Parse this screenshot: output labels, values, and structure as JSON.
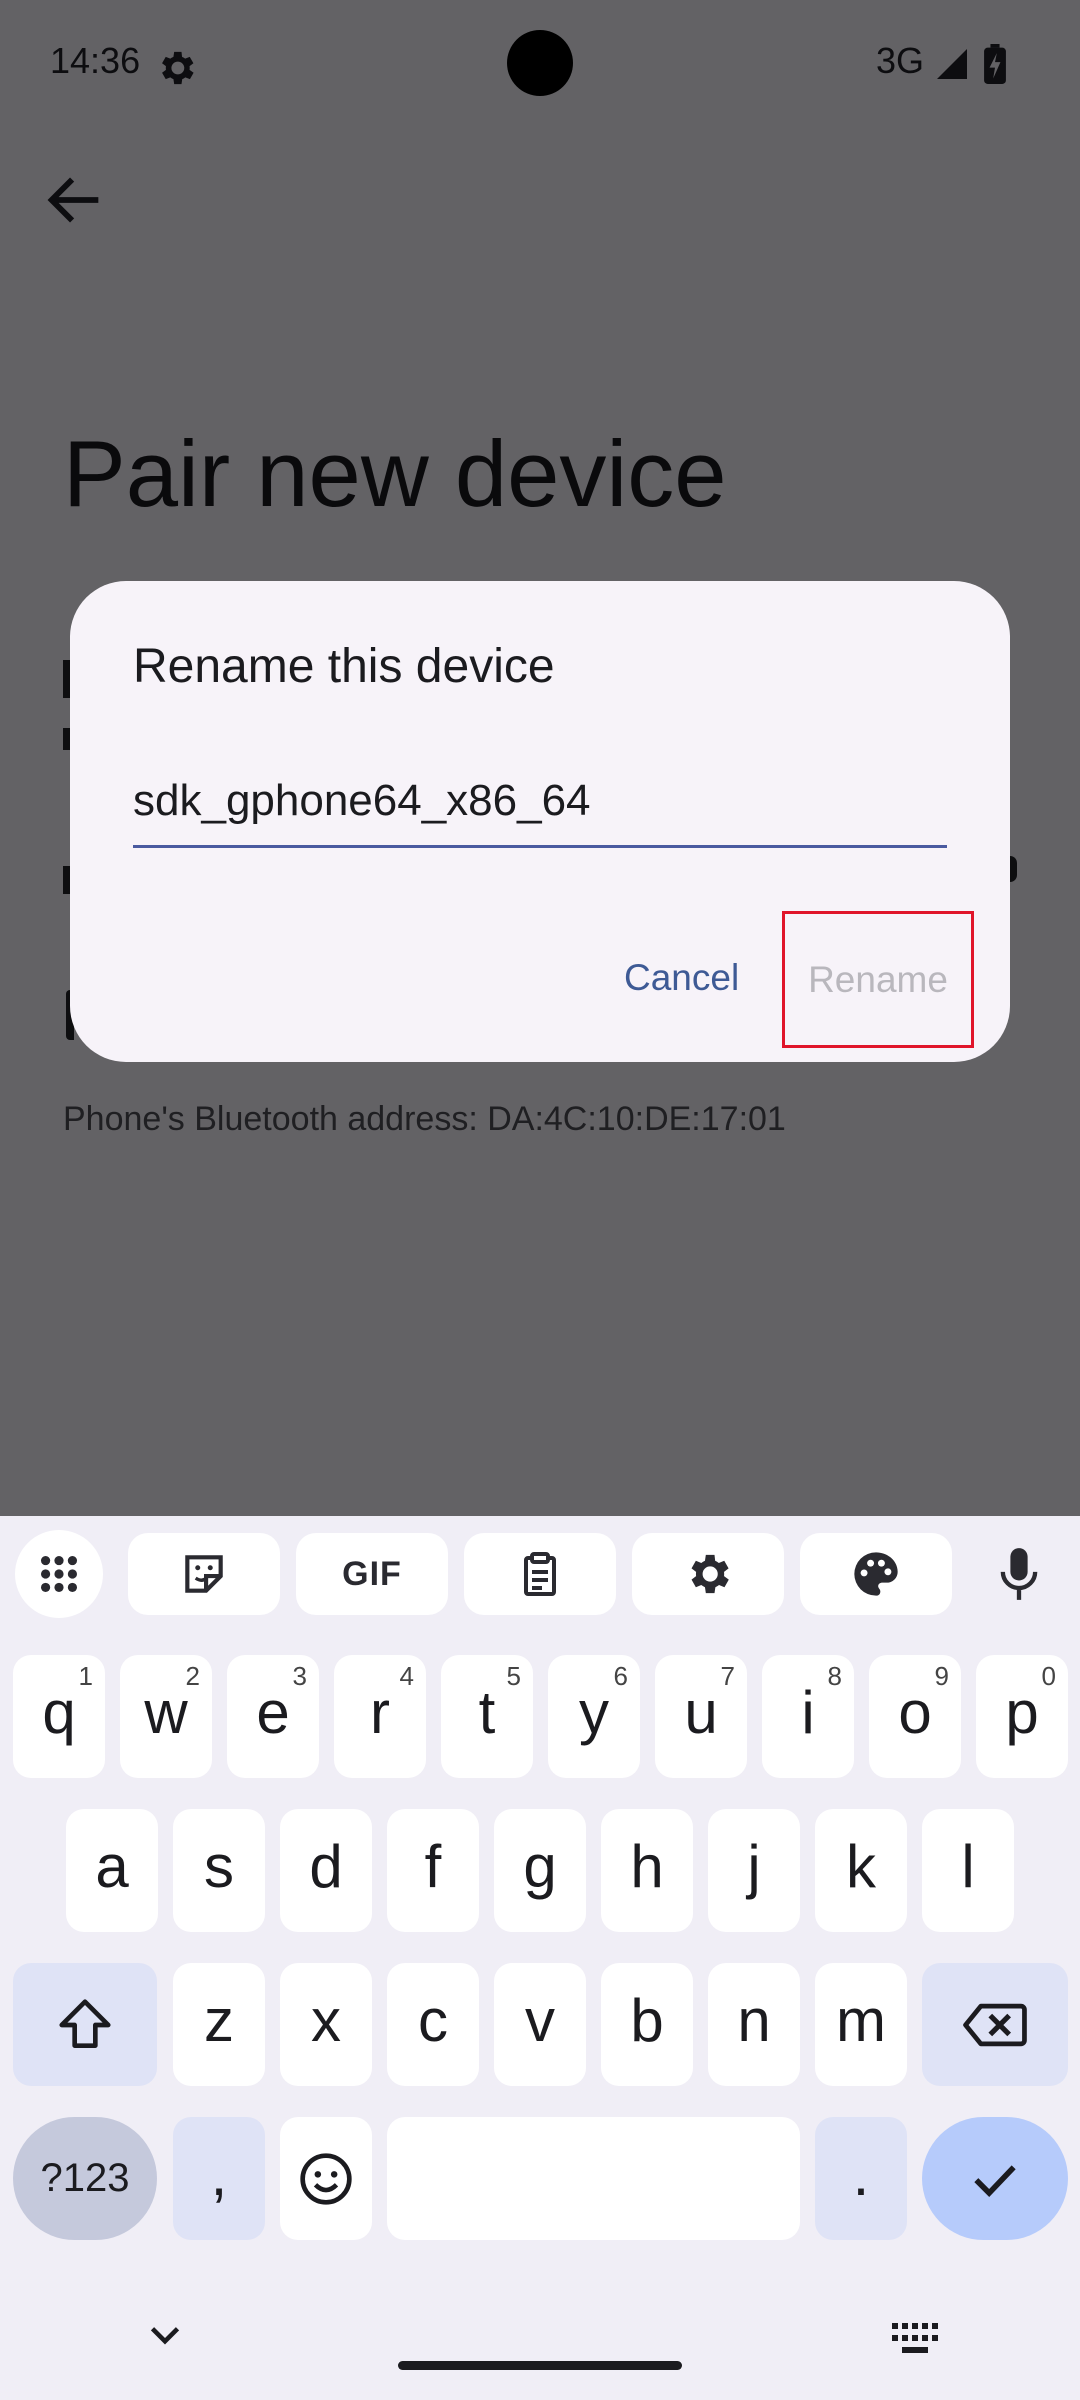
{
  "status_bar": {
    "time": "14:36",
    "network": "3G",
    "icons": [
      "settings-gear-icon",
      "signal-icon",
      "battery-charging-icon"
    ]
  },
  "page": {
    "title": "Pair new device",
    "bluetooth_address": "Phone's Bluetooth address: DA:4C:10:DE:17:01"
  },
  "dialog": {
    "title": "Rename this device",
    "field_value": "sdk_gphone64_x86_64",
    "cancel_label": "Cancel",
    "rename_label": "Rename"
  },
  "keyboard": {
    "toolbar": {
      "gif_label": "GIF",
      "icons": [
        "apps-grid-icon",
        "sticker-icon",
        "clipboard-icon",
        "settings-icon",
        "palette-icon",
        "microphone-icon"
      ]
    },
    "row1": [
      {
        "ch": "q",
        "hint": "1"
      },
      {
        "ch": "w",
        "hint": "2"
      },
      {
        "ch": "e",
        "hint": "3"
      },
      {
        "ch": "r",
        "hint": "4"
      },
      {
        "ch": "t",
        "hint": "5"
      },
      {
        "ch": "y",
        "hint": "6"
      },
      {
        "ch": "u",
        "hint": "7"
      },
      {
        "ch": "i",
        "hint": "8"
      },
      {
        "ch": "o",
        "hint": "9"
      },
      {
        "ch": "p",
        "hint": "0"
      }
    ],
    "row2": [
      "a",
      "s",
      "d",
      "f",
      "g",
      "h",
      "j",
      "k",
      "l"
    ],
    "row3": [
      "z",
      "x",
      "c",
      "v",
      "b",
      "n",
      "m"
    ],
    "symbols_label": "?123",
    "comma": ",",
    "period": "."
  },
  "colors": {
    "accent": "#3e5a95",
    "highlight_box": "#e0142a",
    "scrim": "#636265",
    "enter_key": "#b6cbfb"
  }
}
